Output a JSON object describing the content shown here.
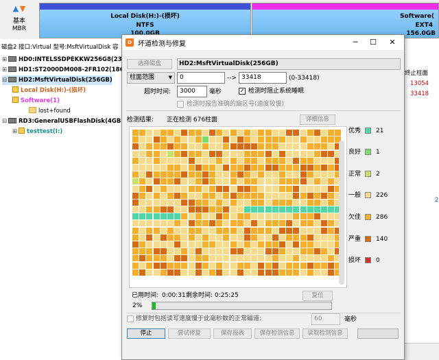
{
  "background": {
    "nav_label1": "基本",
    "nav_label2": "MBR",
    "partitions": [
      {
        "name": "Local Disk(H:)-(损坏)",
        "fs": "NTFS",
        "size": "100.0GB",
        "stripe_color": "#3f52d6"
      },
      {
        "name": "Software(",
        "fs": "EXT4",
        "size": "156.0GB",
        "stripe_color": "#f02ef0"
      }
    ],
    "info_bar": "磁盘2 接口:Virtual  型号:MsftVirtualDisk  容",
    "tree": [
      {
        "label": "HD0:INTELSSDPEKKW256G8(238G",
        "color": "#000000"
      },
      {
        "label": "HD1:ST2000DM008-2FR102(1863G",
        "color": "#000000"
      },
      {
        "label": "HD2:MsftVirtualDisk(256GB)",
        "color": "#000000"
      },
      {
        "label": "Local Disk(H:)-(损坏)",
        "color": "#c8621e"
      },
      {
        "label": "Software(1)",
        "color": "#e23de2"
      },
      {
        "label": "lost+found",
        "color": "#000000"
      },
      {
        "label": "RD3:GeneralUSBFlashDisk(4GB)",
        "color": "#000000"
      },
      {
        "label": "testtest(I:)",
        "color": "#1a8c8c"
      }
    ],
    "right_col": {
      "header": "终止柱面",
      "r1": "13054",
      "r2": "33418",
      "extra": "2"
    }
  },
  "dialog": {
    "title": "坏道检测与修复",
    "select_disk_btn": "选择磁盘",
    "disk_name": "HD2:MsftVirtualDisk(256GB)",
    "range_type": "柱面范围",
    "range_from": "0",
    "range_arrow": "-->",
    "range_to": "33418",
    "range_hint": "(0-33418)",
    "timeout_label": "超时时间:",
    "timeout_value": "3000",
    "timeout_unit": "毫秒",
    "prevent_sleep": "检测时阻止系统睡眠",
    "report_sectors": "检测时报告准确的扇区号(速度较慢)",
    "result_label": "检测结果:",
    "status_text": "正在检测 676柱面",
    "details_btn": "详细信息",
    "legend": [
      {
        "label": "优秀",
        "count": "21",
        "color": "#4fd7a8"
      },
      {
        "label": "良好",
        "count": "1",
        "color": "#7ddb68"
      },
      {
        "label": "正常",
        "count": "2",
        "color": "#c9e06c"
      },
      {
        "label": "一般",
        "count": "226",
        "color": "#f7db8c"
      },
      {
        "label": "欠佳",
        "count": "286",
        "color": "#f4b02c"
      },
      {
        "label": "严重",
        "count": "140",
        "color": "#d76b14"
      },
      {
        "label": "损坏",
        "count": "0",
        "color": "#d23232"
      }
    ],
    "used_time_label": "已用时间:",
    "used_time": "0:00:31",
    "remaining_label": "剩余时间:",
    "remaining_time": "0:25:25",
    "reset_btn": "复位",
    "percent": "2%",
    "progress": 0.02,
    "repair_option": "修复时包括读写速度慢于此毫秒数的正常磁道:",
    "repair_ms": "60",
    "repair_unit": "毫秒",
    "buttons": [
      "停止",
      "尝试修复",
      "保存报表",
      "保存检测信息",
      "读取检测信息"
    ]
  }
}
